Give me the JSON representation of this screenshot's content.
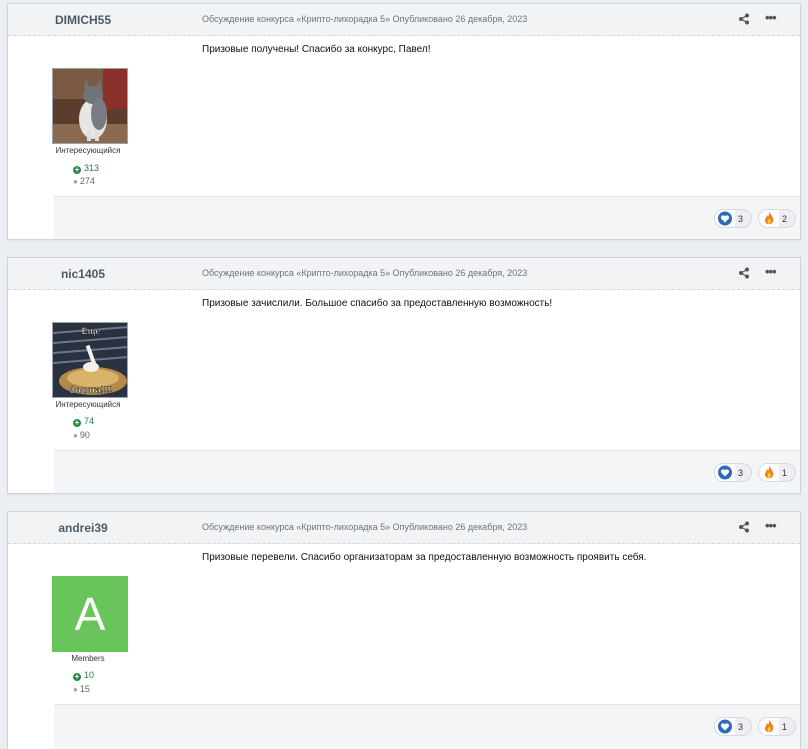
{
  "posts": [
    {
      "author": "DIMICH55",
      "meta": "Обсуждение конкурса «Крипто-лихорадка 5» Опубликовано 26 декабря, 2023",
      "text": "Призовые  получены! Спасибо за  конкурс, Павел!",
      "rank": "Интересующийся",
      "reputation": "313",
      "post_count": "274",
      "avatar_type": "cat-photo",
      "reactions": {
        "like": "3",
        "fire": "2"
      }
    },
    {
      "author": "nic1405",
      "meta": "Обсуждение конкурса «Крипто-лихорадка 5» Опубликовано 26 декабря, 2023",
      "text": "Призовые зачислили. Большое спасибо за предоставленную возможность!",
      "rank": "Интересующийся",
      "reputation": "74",
      "post_count": "90",
      "avatar_type": "meme-image",
      "avatar_caption_top": "Еще",
      "avatar_caption_bottom": "Золота!!!!",
      "reactions": {
        "like": "3",
        "fire": "1"
      }
    },
    {
      "author": "andrei39",
      "meta": "Обсуждение конкурса «Крипто-лихорадка 5» Опубликовано 26 декабря, 2023",
      "text": "Призовые перевели. Спасибо организаторам за предоставленную возможность проявить себя.",
      "rank": "Members",
      "reputation": "10",
      "post_count": "15",
      "avatar_type": "letter",
      "avatar_letter": "A",
      "avatar_color": "#6ac45c",
      "reactions": {
        "like": "3",
        "fire": "1"
      }
    }
  ],
  "icons": {
    "share": "share-icon",
    "more": "more-options-icon",
    "reputation": "plus-circle-icon",
    "posts": "speech-bubble-icon",
    "like": "heart-icon",
    "fire": "fire-icon"
  }
}
